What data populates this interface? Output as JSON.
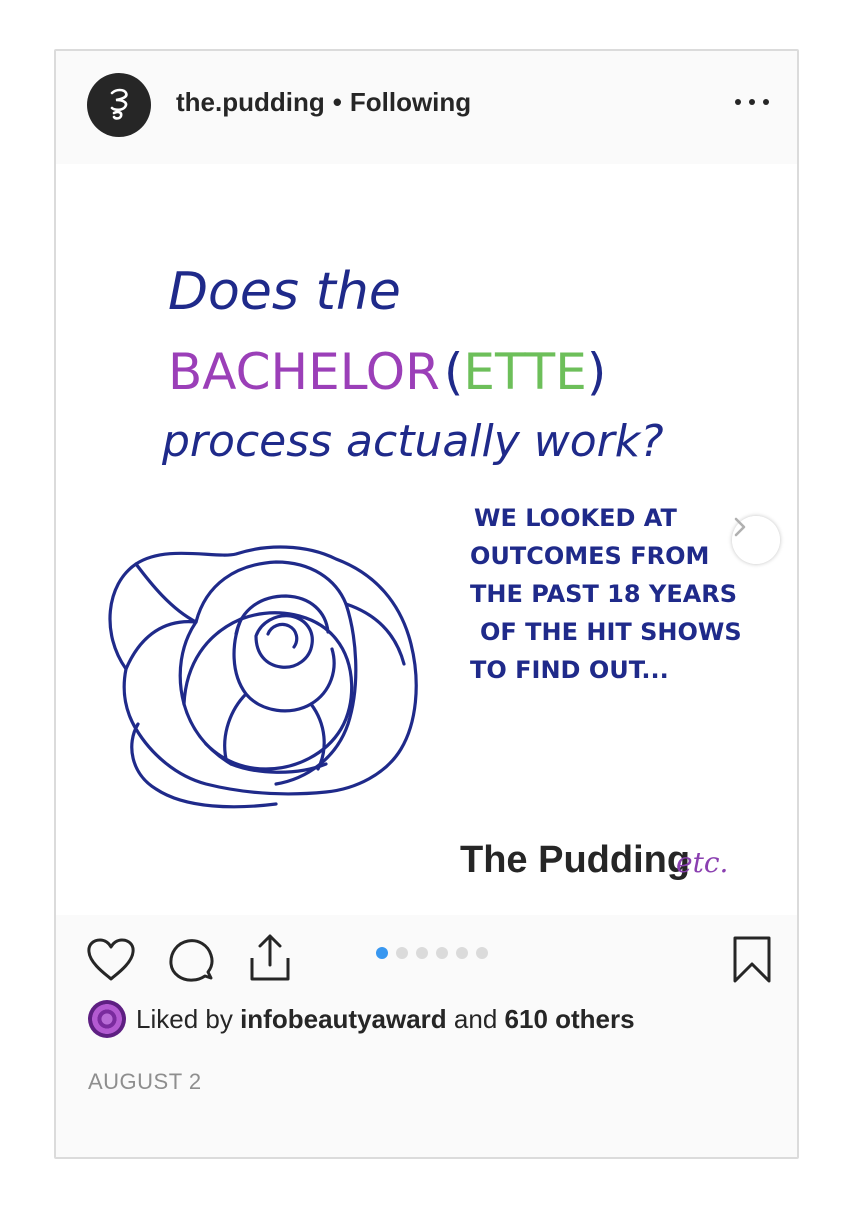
{
  "post": {
    "username": "the.pudding",
    "separator": "•",
    "follow_status": "Following",
    "more_icon": "more-horizontal-icon"
  },
  "image": {
    "headline_line1": "Does the",
    "headline_bachelor": "BACHELOR",
    "headline_paren_open": "(",
    "headline_ette": "ETTE",
    "headline_paren_close": ")",
    "headline_line3": "process actually work?",
    "side_text": [
      "WE LOOKED AT",
      "OUTCOMES FROM",
      "THE PAST 18 YEARS",
      "OF THE HIT SHOWS",
      "TO FIND OUT..."
    ],
    "brand": "The Pudding",
    "brand_suffix": "etc.",
    "colors": {
      "ink": "#1f2a8a",
      "bachelor": "#9b3fb8",
      "ette": "#6dbf5a",
      "brand_suffix": "#8a3fb0"
    }
  },
  "carousel": {
    "count": 6,
    "active": 0,
    "active_color": "#3897f0",
    "next_icon": "chevron-right-icon"
  },
  "actions": {
    "like_icon": "heart-icon",
    "comment_icon": "comment-icon",
    "share_icon": "share-icon",
    "save_icon": "bookmark-icon"
  },
  "likes": {
    "prefix": "Liked by",
    "user": "infobeautyaward",
    "conj": "and",
    "others": "610 others"
  },
  "date": "AUGUST 2"
}
